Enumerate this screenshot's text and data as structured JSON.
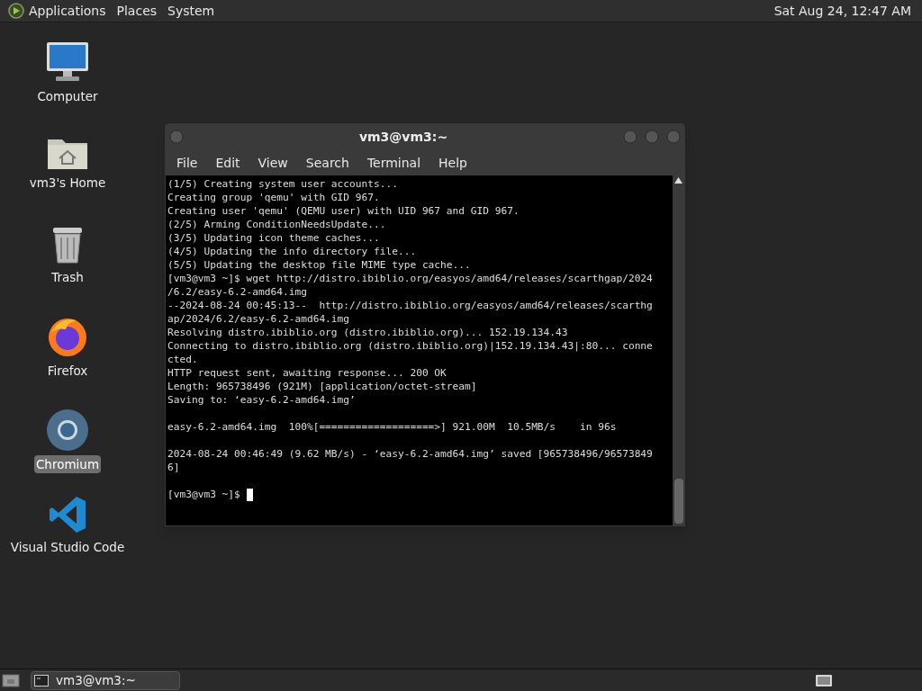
{
  "top_panel": {
    "menus": [
      "Applications",
      "Places",
      "System"
    ],
    "clock": "Sat Aug 24, 12:47 AM"
  },
  "desktop_icons": [
    {
      "kind": "computer",
      "label": "Computer",
      "selected": false
    },
    {
      "kind": "home",
      "label": "vm3's Home",
      "selected": false
    },
    {
      "kind": "trash",
      "label": "Trash",
      "selected": false
    },
    {
      "kind": "firefox",
      "label": "Firefox",
      "selected": false
    },
    {
      "kind": "chromium",
      "label": "Chromium",
      "selected": true
    },
    {
      "kind": "vscode",
      "label": "Visual Studio Code",
      "selected": false
    }
  ],
  "terminal": {
    "title": "vm3@vm3:~",
    "menu": [
      "File",
      "Edit",
      "View",
      "Search",
      "Terminal",
      "Help"
    ],
    "blocks": [
      [
        "(1/5) Creating system user accounts...",
        "Creating group 'qemu' with GID 967.",
        "Creating user 'qemu' (QEMU user) with UID 967 and GID 967.",
        "(2/5) Arming ConditionNeedsUpdate...",
        "(3/5) Updating icon theme caches...",
        "(4/5) Updating the info directory file...",
        "(5/5) Updating the desktop file MIME type cache...",
        "[vm3@vm3 ~]$ wget http://distro.ibiblio.org/easyos/amd64/releases/scarthgap/2024",
        "/6.2/easy-6.2-amd64.img",
        "--2024-08-24 00:45:13--  http://distro.ibiblio.org/easyos/amd64/releases/scarthg",
        "ap/2024/6.2/easy-6.2-amd64.img",
        "Resolving distro.ibiblio.org (distro.ibiblio.org)... 152.19.134.43",
        "Connecting to distro.ibiblio.org (distro.ibiblio.org)|152.19.134.43|:80... conne",
        "cted.",
        "HTTP request sent, awaiting response... 200 OK",
        "Length: 965738496 (921M) [application/octet-stream]",
        "Saving to: ‘easy-6.2-amd64.img’"
      ],
      [
        "easy-6.2-amd64.img  100%[===================>] 921.00M  10.5MB/s    in 96s"
      ],
      [
        "2024-08-24 00:46:49 (9.62 MB/s) - ‘easy-6.2-amd64.img’ saved [965738496/96573849",
        "6]"
      ]
    ],
    "prompt": "[vm3@vm3 ~]$"
  },
  "taskbar": {
    "tasks": [
      {
        "label": "vm3@vm3:~",
        "selected": false
      }
    ]
  }
}
